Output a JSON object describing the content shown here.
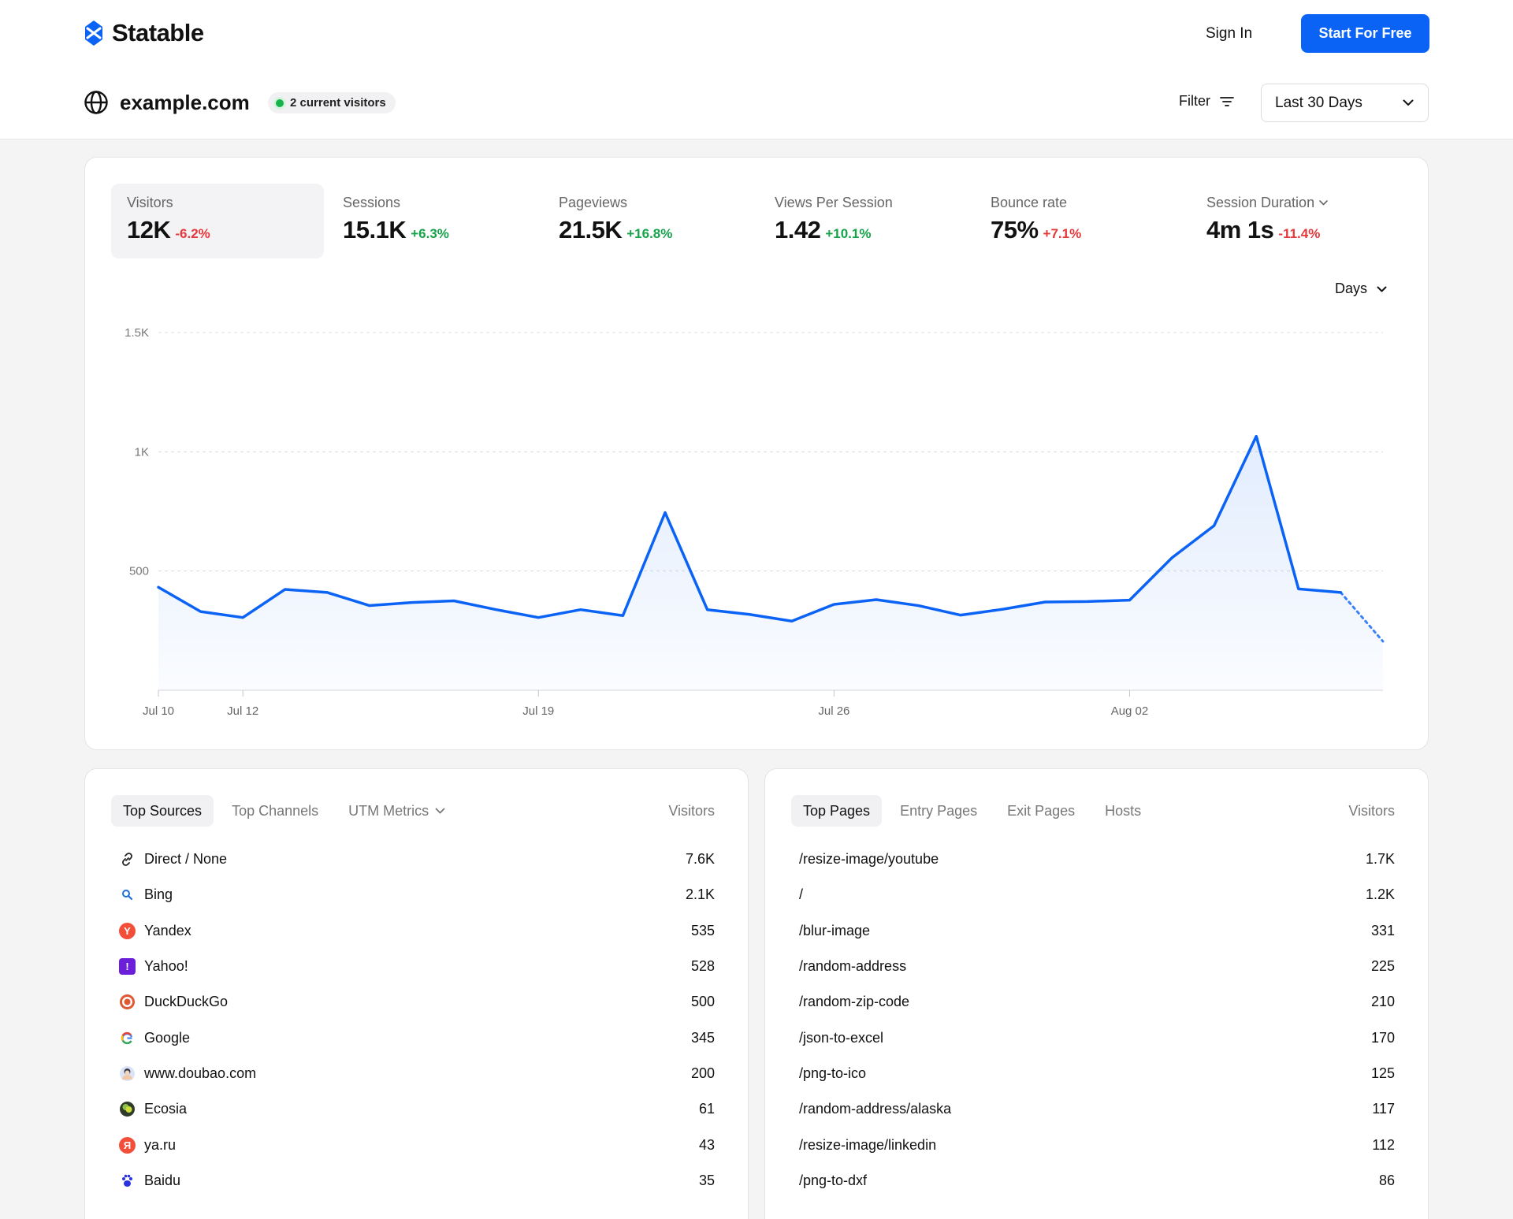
{
  "brand": {
    "name": "Statable"
  },
  "nav": {
    "sign_in": "Sign In",
    "cta": "Start For Free"
  },
  "site": {
    "domain": "example.com",
    "live_visitors": "2 current visitors"
  },
  "controls": {
    "filter": "Filter",
    "range": "Last 30 Days",
    "interval": "Days"
  },
  "metrics": [
    {
      "label": "Visitors",
      "value": "12K",
      "change": "-6.2%",
      "trend": "down"
    },
    {
      "label": "Sessions",
      "value": "15.1K",
      "change": "+6.3%",
      "trend": "up"
    },
    {
      "label": "Pageviews",
      "value": "21.5K",
      "change": "+16.8%",
      "trend": "up"
    },
    {
      "label": "Views Per Session",
      "value": "1.42",
      "change": "+10.1%",
      "trend": "up"
    },
    {
      "label": "Bounce rate",
      "value": "75%",
      "change": "+7.1%",
      "trend": "bad"
    },
    {
      "label": "Session Duration",
      "value": "4m 1s",
      "change": "-11.4%",
      "trend": "down"
    }
  ],
  "chart_data": {
    "type": "line",
    "series": [
      {
        "values": [
          432,
          330,
          305,
          423,
          410,
          355,
          368,
          375,
          338,
          305,
          338,
          313,
          745,
          338,
          318,
          290,
          360,
          380,
          355,
          315,
          340,
          370,
          372,
          378,
          555,
          690,
          1065,
          425,
          410,
          205
        ]
      }
    ],
    "x_labels": [
      "Jul 10",
      "Jul 12",
      "Jul 19",
      "Jul 26",
      "Aug 02"
    ],
    "y_ticks": [
      "500",
      "1K",
      "1.5K"
    ],
    "ylim": [
      0,
      1500
    ],
    "last_segment_projected": true,
    "line_color": "#0b63f6",
    "grid": true
  },
  "sources": {
    "tabs": [
      "Top Sources",
      "Top Channels",
      "UTM Metrics"
    ],
    "column": "Visitors",
    "rows": [
      {
        "name": "Direct / None",
        "value": "7.6K",
        "icon": "link-icon"
      },
      {
        "name": "Bing",
        "value": "2.1K",
        "icon": "bing-icon"
      },
      {
        "name": "Yandex",
        "value": "535",
        "icon": "yandex-icon"
      },
      {
        "name": "Yahoo!",
        "value": "528",
        "icon": "yahoo-icon"
      },
      {
        "name": "DuckDuckGo",
        "value": "500",
        "icon": "duckduckgo-icon"
      },
      {
        "name": "Google",
        "value": "345",
        "icon": "google-icon"
      },
      {
        "name": "www.doubao.com",
        "value": "200",
        "icon": "doubao-icon"
      },
      {
        "name": "Ecosia",
        "value": "61",
        "icon": "ecosia-icon"
      },
      {
        "name": "ya.ru",
        "value": "43",
        "icon": "yaru-icon"
      },
      {
        "name": "Baidu",
        "value": "35",
        "icon": "baidu-icon"
      }
    ]
  },
  "pages": {
    "tabs": [
      "Top Pages",
      "Entry Pages",
      "Exit Pages",
      "Hosts"
    ],
    "column": "Visitors",
    "rows": [
      {
        "name": "/resize-image/youtube",
        "value": "1.7K"
      },
      {
        "name": "/",
        "value": "1.2K"
      },
      {
        "name": "/blur-image",
        "value": "331"
      },
      {
        "name": "/random-address",
        "value": "225"
      },
      {
        "name": "/random-zip-code",
        "value": "210"
      },
      {
        "name": "/json-to-excel",
        "value": "170"
      },
      {
        "name": "/png-to-ico",
        "value": "125"
      },
      {
        "name": "/random-address/alaska",
        "value": "117"
      },
      {
        "name": "/resize-image/linkedin",
        "value": "112"
      },
      {
        "name": "/png-to-dxf",
        "value": "86"
      }
    ]
  }
}
